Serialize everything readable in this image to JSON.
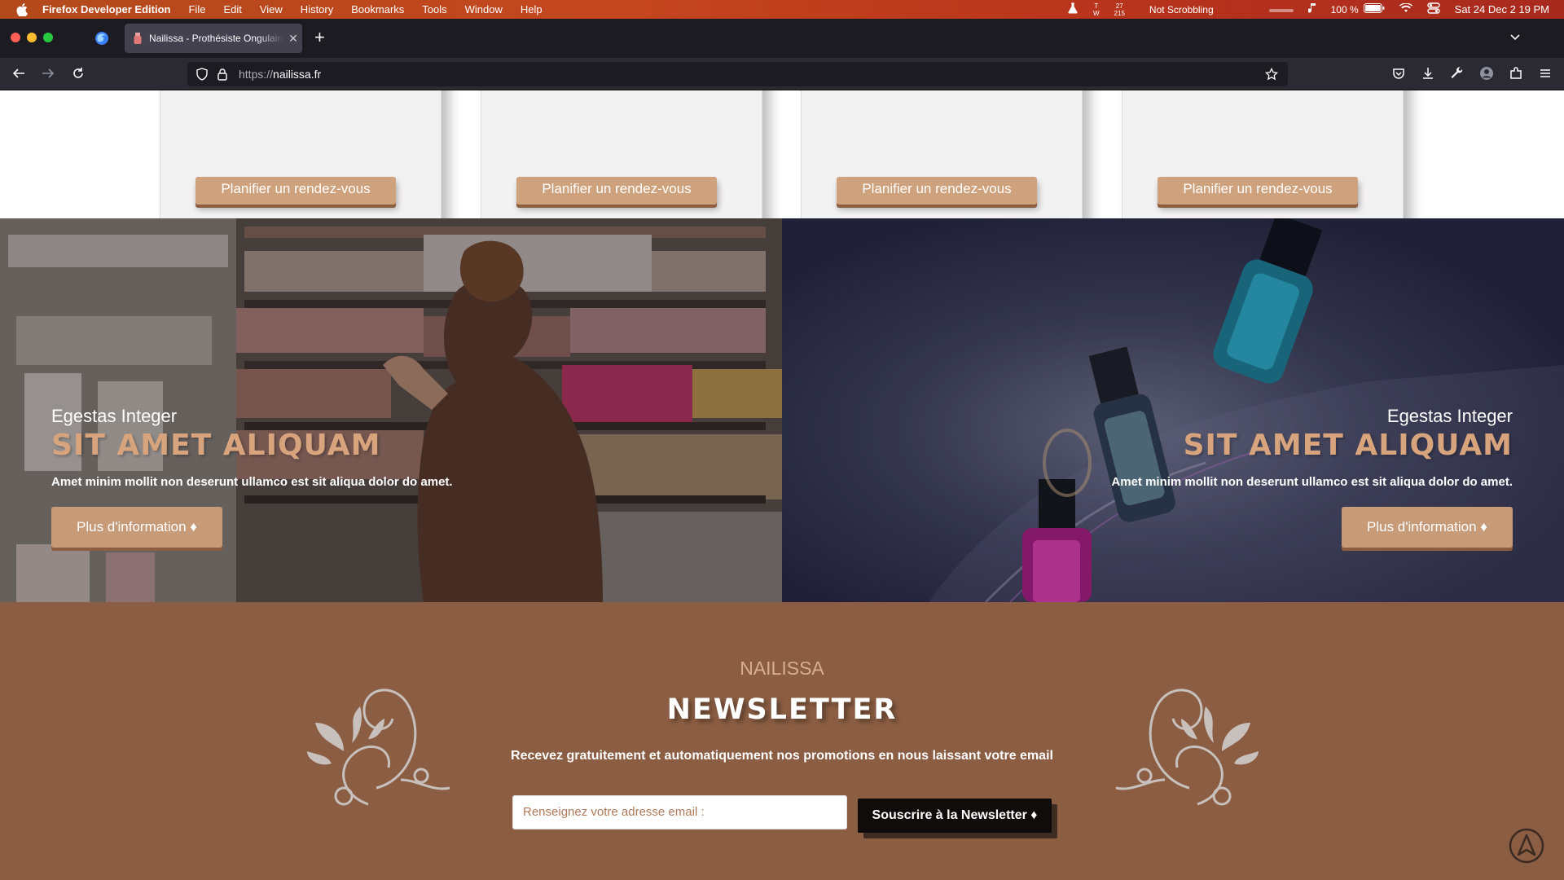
{
  "menubar": {
    "app_name": "Firefox Developer Edition",
    "items": [
      "File",
      "Edit",
      "View",
      "History",
      "Bookmarks",
      "Tools",
      "Window",
      "Help"
    ],
    "status": {
      "tw_top": "T",
      "tw_bottom": "W",
      "counts_top": "27",
      "counts_bottom": "215",
      "scrobble": "Not Scrobbling",
      "battery": "100 %",
      "datetime": "Sat 24 Dec  2 19 PM"
    }
  },
  "browser": {
    "tab_title": "Nailissa - Prothésiste Ongulaire",
    "url_scheme": "https://",
    "url_host": "nailissa.fr"
  },
  "cards": {
    "button_label": "Planifier un rendez-vous"
  },
  "promos": [
    {
      "subtitle": "Egestas Integer",
      "title": "SIT AMET ALIQUAM",
      "description": "Amet minim mollit non deserunt ullamco est sit aliqua dolor do amet.",
      "button": "Plus d'information ♦"
    },
    {
      "subtitle": "Egestas Integer",
      "title": "SIT AMET ALIQUAM",
      "description": "Amet minim mollit non deserunt ullamco est sit aliqua dolor do amet.",
      "button": "Plus d'information ♦"
    }
  ],
  "newsletter": {
    "brand": "NAILISSA",
    "title": "NEWSLETTER",
    "description": "Recevez gratuitement et automatiquement nos promotions en nous laissant votre email",
    "placeholder": "Renseignez votre adresse email :",
    "button": "Souscrire à la Newsletter ♦"
  },
  "colors": {
    "accent": "#cfa27e",
    "newsletter_bg": "#8b5e43",
    "title_accent": "#d8a47e"
  }
}
